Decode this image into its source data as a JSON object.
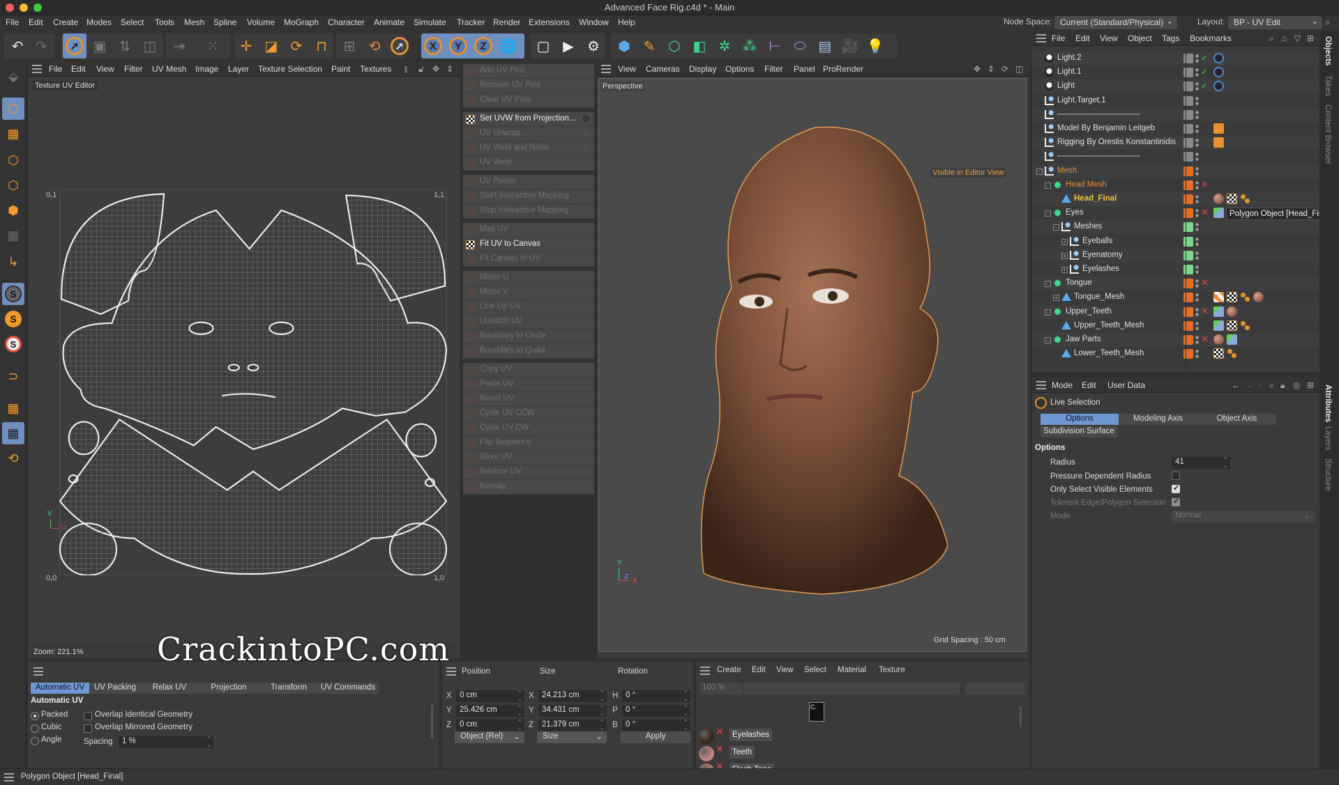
{
  "window": {
    "title": "Advanced Face Rig.c4d * - Main"
  },
  "menubar": {
    "items": [
      "File",
      "Edit",
      "Create",
      "Modes",
      "Select",
      "Tools",
      "Mesh",
      "Spline",
      "Volume",
      "MoGraph",
      "Character",
      "Animate",
      "Simulate",
      "Tracker",
      "Render",
      "Extensions",
      "Window",
      "Help"
    ],
    "node_space_label": "Node Space:",
    "node_space_value": "Current (Standard/Physical)",
    "layout_label": "Layout:",
    "layout_value": "BP - UV Edit"
  },
  "toolbar": {
    "icons": [
      "undo-icon",
      "redo-icon",
      "live-selection-icon",
      "move-selected-icon",
      "transfer-icon",
      "scale-selected-icon",
      "mirror-icon",
      "array-icon",
      "move-icon",
      "scale-icon",
      "rotate-icon",
      "snap-icon",
      "coordinate-system-icon",
      "psr-reset-icon",
      "select-icon",
      "lock-x-icon",
      "lock-y-icon",
      "lock-z-icon",
      "world-coords-icon",
      "render-view-icon",
      "render-picture-viewer-icon",
      "render-settings-icon",
      "cube-icon",
      "pen-icon",
      "subdivision-icon",
      "extrude-icon",
      "cloner-icon",
      "mograph-icon",
      "deformer-icon",
      "field-icon",
      "floor-icon",
      "camera-icon",
      "light-icon"
    ],
    "axis_labels": [
      "X",
      "Y",
      "Z"
    ]
  },
  "left_tools": [
    "object-mode-icon",
    "uv-polygon-mode-icon",
    "points-mode-icon",
    "edges-mode-icon",
    "polygons-mode-icon",
    "uv-points-icon",
    "axis-icon",
    "solo-icon",
    "solo-hierarchy-icon",
    "solo-selection-icon",
    "snap-magnet-icon",
    "workplane-icon",
    "locked-workplane-icon",
    "workplane-rotate-icon"
  ],
  "uv_editor": {
    "menu": [
      "File",
      "Edit",
      "View",
      "Filter",
      "UV Mesh",
      "Image",
      "Layer",
      "Texture Selection",
      "Paint",
      "Textures"
    ],
    "label": "Texture UV Editor",
    "corner_labels": {
      "top_left": "0,1",
      "top_right": "1,1",
      "bottom_left": "0,0",
      "bottom_right": "1,0"
    },
    "axis_v": "V",
    "axis_u": "U",
    "zoom": "Zoom: 221.1%"
  },
  "uv_commands": {
    "groups": [
      [
        {
          "label": "Add UV Pins",
          "enabled": false
        },
        {
          "label": "Remove UV Pins",
          "enabled": false
        },
        {
          "label": "Clear UV Pins",
          "enabled": false
        }
      ],
      [
        {
          "label": "Set UVW from Projection...",
          "enabled": true,
          "gear": true
        },
        {
          "label": "UV Unwrap...",
          "enabled": false,
          "gear": true
        },
        {
          "label": "UV Weld and Relax...",
          "enabled": false,
          "gear": true
        },
        {
          "label": "UV Weld",
          "enabled": false
        }
      ],
      [
        {
          "label": "UV Peeler",
          "enabled": false
        },
        {
          "label": "Start Interactive Mapping",
          "enabled": false
        },
        {
          "label": "Stop Interactive Mapping",
          "enabled": false
        }
      ],
      [
        {
          "label": "Max UV",
          "enabled": false
        },
        {
          "label": "Fit UV to Canvas",
          "enabled": true
        },
        {
          "label": "Fit Canvas to UV",
          "enabled": false
        }
      ],
      [
        {
          "label": "Mirror U",
          "enabled": false
        },
        {
          "label": "Mirror V",
          "enabled": false
        },
        {
          "label": "Line Up UV",
          "enabled": false
        },
        {
          "label": "Unstitch UV",
          "enabled": false
        },
        {
          "label": "Boundary to Circle",
          "enabled": false
        },
        {
          "label": "Boundary to Quad",
          "enabled": false
        }
      ],
      [
        {
          "label": "Copy UV",
          "enabled": false
        },
        {
          "label": "Paste UV",
          "enabled": false
        },
        {
          "label": "Reset UV",
          "enabled": false
        },
        {
          "label": "Cycle UV CCW",
          "enabled": false
        },
        {
          "label": "Cycle UV CW",
          "enabled": false
        },
        {
          "label": "Flip Sequence",
          "enabled": false
        },
        {
          "label": "Store UV",
          "enabled": false
        },
        {
          "label": "Restore UV",
          "enabled": false
        },
        {
          "label": "Remap...",
          "enabled": false
        }
      ]
    ]
  },
  "viewport": {
    "menu": [
      "View",
      "Cameras",
      "Display",
      "Options",
      "Filter",
      "Panel",
      "ProRender"
    ],
    "label": "Perspective",
    "badge": "Visible in Editor View",
    "grid_spacing": "Grid Spacing : 50 cm",
    "axis": {
      "y": "Y",
      "z": "Z",
      "x": "X"
    }
  },
  "object_manager": {
    "menu": [
      "File",
      "Edit",
      "View",
      "Object",
      "Tags",
      "Bookmarks"
    ],
    "rows": [
      {
        "name": "Light.2",
        "indent": 0,
        "icon": "light",
        "vis": "gray",
        "check": true,
        "tags": [
          "target-tag"
        ]
      },
      {
        "name": "Light.1",
        "indent": 0,
        "icon": "light",
        "vis": "gray",
        "check": true,
        "tags": [
          "target-tag"
        ]
      },
      {
        "name": "Light",
        "indent": 0,
        "icon": "light",
        "vis": "gray",
        "check": true,
        "tags": [
          "target-tag"
        ]
      },
      {
        "name": "Light.Target.1",
        "indent": 0,
        "icon": "null",
        "vis": "gray",
        "tags": []
      },
      {
        "name": "-------------------------------",
        "indent": 0,
        "icon": "null",
        "vis": "gray",
        "tags": []
      },
      {
        "name": "Model By Benjamin Leitgeb",
        "indent": 0,
        "icon": "null",
        "vis": "gray",
        "tags": [
          "annotation-tag"
        ]
      },
      {
        "name": "Rigging By Orestis Konstantinidis",
        "indent": 0,
        "icon": "null",
        "vis": "gray",
        "tags": [
          "annotation-tag"
        ]
      },
      {
        "name": "-------------------------------",
        "indent": 0,
        "icon": "null",
        "vis": "gray",
        "tags": []
      },
      {
        "name": "Mesh",
        "indent": 0,
        "icon": "null",
        "vis": "orange",
        "color": "#e08a3c",
        "expand": "-",
        "tags": []
      },
      {
        "name": "Head Mesh",
        "indent": 1,
        "icon": "subd",
        "vis": "orange",
        "color": "#e08a3c",
        "x": true,
        "expand": "-",
        "tags": []
      },
      {
        "name": "Head_Final",
        "indent": 2,
        "icon": "poly",
        "vis": "orange",
        "color": "#f2c53a",
        "bold": true,
        "tags": [
          "material-tag",
          "uvw-tag",
          "selection-tag"
        ]
      },
      {
        "name": "Eyes",
        "indent": 1,
        "icon": "subd",
        "vis": "orange",
        "x": true,
        "expand": "-",
        "tags": [
          "constraint-tag",
          "material-tag"
        ]
      },
      {
        "name": "Meshes",
        "indent": 2,
        "icon": "null",
        "vis": "green",
        "expand": "-",
        "tags": []
      },
      {
        "name": "Eyeballs",
        "indent": 3,
        "icon": "null",
        "vis": "green",
        "expand": "+",
        "tags": []
      },
      {
        "name": "Eyenatomy",
        "indent": 3,
        "icon": "null",
        "vis": "green",
        "expand": "+",
        "tags": []
      },
      {
        "name": "Eyelashes",
        "indent": 3,
        "icon": "null",
        "vis": "green",
        "expand": "+",
        "tags": []
      },
      {
        "name": "Tongue",
        "indent": 1,
        "icon": "subd",
        "vis": "orange",
        "x": true,
        "expand": "-",
        "tags": []
      },
      {
        "name": "Tongue_Mesh",
        "indent": 2,
        "icon": "poly",
        "vis": "orange",
        "expand": "+",
        "tags": [
          "phong-tag",
          "uvw-tag",
          "selection-tag",
          "material-tag"
        ]
      },
      {
        "name": "Upper_Teeth",
        "indent": 1,
        "icon": "subd",
        "vis": "orange",
        "x": true,
        "expand": "-",
        "tags": [
          "constraint-tag",
          "material-tag"
        ]
      },
      {
        "name": "Upper_Teeth_Mesh",
        "indent": 2,
        "icon": "poly",
        "vis": "orange",
        "tags": [
          "constraint-tag",
          "uvw-tag",
          "selection-tag"
        ]
      },
      {
        "name": "Jaw Parts",
        "indent": 1,
        "icon": "subd",
        "vis": "orange",
        "x": true,
        "expand": "-",
        "tags": [
          "material-tag",
          "constraint-tag"
        ]
      },
      {
        "name": "Lower_Teeth_Mesh",
        "indent": 2,
        "icon": "poly",
        "vis": "orange",
        "tags": [
          "uvw-tag",
          "selection-tag"
        ]
      }
    ],
    "tooltip": "Polygon Object [Head_Final]"
  },
  "attributes": {
    "menu": [
      "Mode",
      "Edit",
      "User Data"
    ],
    "tool_name": "Live Selection",
    "tabs": [
      "Options",
      "Modeling Axis",
      "Object Axis"
    ],
    "active_tab": "Options",
    "tab2": "Subdivision Surface",
    "section": "Options",
    "fields": {
      "radius_label": "Radius",
      "radius_value": "41",
      "pressure_label": "Pressure Dependent Radius",
      "pressure_checked": false,
      "visible_label": "Only Select Visible Elements",
      "visible_checked": true,
      "tolerant_label": "Tolerant Edge/Polygon Selection",
      "tolerant_checked": true,
      "mode_label": "Mode",
      "mode_value": "Normal"
    }
  },
  "side_tabs": {
    "top": [
      "Objects",
      "Takes",
      "Content Browser"
    ],
    "bottom": [
      "Attributes",
      "Layers",
      "Structure"
    ]
  },
  "uv_tools": {
    "tabs": [
      "Automatic UV",
      "UV Packing",
      "Relax UV",
      "Projection",
      "Transform",
      "UV Commands"
    ],
    "active_tab": "Automatic UV",
    "section": "Automatic UV",
    "modes": [
      {
        "label": "Packed",
        "selected": true
      },
      {
        "label": "Cubic",
        "selected": false
      },
      {
        "label": "Angle",
        "selected": false
      }
    ],
    "overlap_identical": "Overlap Identical Geometry",
    "overlap_mirrored": "Overlap Mirrored Geometry",
    "spacing_label": "Spacing",
    "spacing_value": "1 %"
  },
  "coordinates": {
    "headers": [
      "Position",
      "Size",
      "Rotation"
    ],
    "position": [
      {
        "axis": "X",
        "value": "0 cm"
      },
      {
        "axis": "Y",
        "value": "25.426 cm"
      },
      {
        "axis": "Z",
        "value": "0 cm"
      }
    ],
    "size": [
      {
        "axis": "X",
        "value": "24.213 cm"
      },
      {
        "axis": "Y",
        "value": "34.431 cm"
      },
      {
        "axis": "Z",
        "value": "21.379 cm"
      }
    ],
    "rotation": [
      {
        "axis": "H",
        "value": "0 °"
      },
      {
        "axis": "P",
        "value": "0 °"
      },
      {
        "axis": "B",
        "value": "0 °"
      }
    ],
    "mode_select": "Object (Rel)",
    "size_select": "Size",
    "apply": "Apply"
  },
  "materials": {
    "menu": [
      "Create",
      "Edit",
      "View",
      "Select",
      "Material",
      "Texture"
    ],
    "zoom_value": "100 %",
    "layer_label": "C.",
    "items": [
      {
        "name": "Eyelashes",
        "swatch": "#3a2616"
      },
      {
        "name": "Teeth",
        "swatch": "#c88080"
      },
      {
        "name": "Flesh Tone",
        "swatch": "#b77a66"
      }
    ]
  },
  "status": {
    "text": "Polygon Object [Head_Final]"
  },
  "watermark": "CrackintoPC.com"
}
